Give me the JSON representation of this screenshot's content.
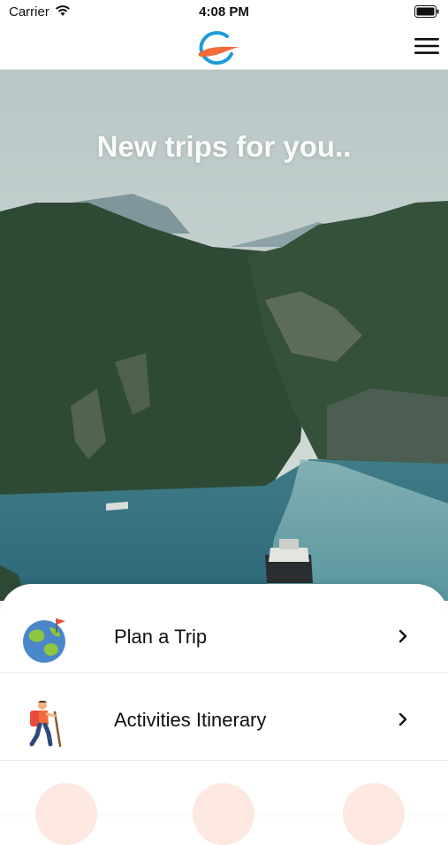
{
  "status_bar": {
    "carrier": "Carrier",
    "time": "4:08 PM"
  },
  "hero": {
    "title": "New trips for you.."
  },
  "menu": [
    {
      "label": "Plan a Trip",
      "icon": "globe-icon"
    },
    {
      "label": "Activities Itinerary",
      "icon": "hiker-icon"
    }
  ],
  "colors": {
    "accent_orange": "#F26B3A",
    "accent_blue": "#1E9BD7",
    "peek_circle": "#FDE8E2"
  }
}
